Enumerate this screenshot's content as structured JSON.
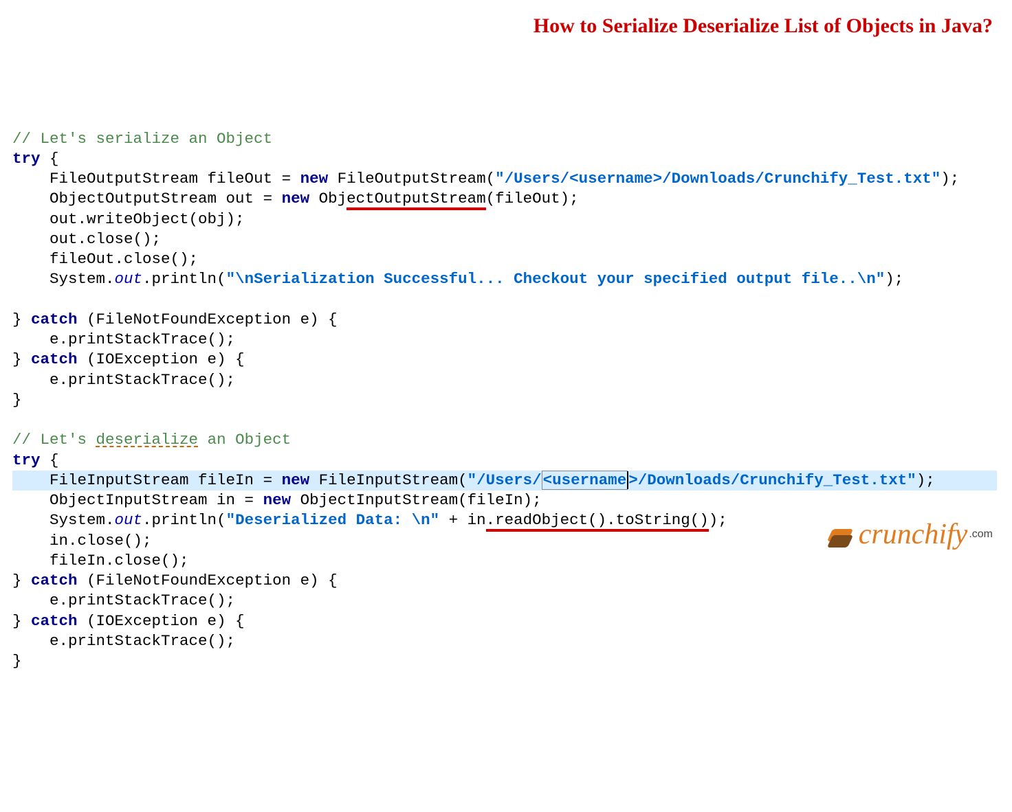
{
  "title": "How to Serialize Deserialize List of Objects in Java?",
  "logo": {
    "name": "crunchify",
    "suffix": ".com"
  },
  "code": {
    "comment1_pre": "// Let's serialize ",
    "comment1_post": "an Object",
    "try": "try",
    "brace_open": " {",
    "ind": "    ",
    "l1_a": "FileOutputStream fileOut = ",
    "kw_new": "new",
    "l1_b": " FileOutputStream(",
    "str1": "\"/Users/<username>/Downloads/Crunchify_Test.txt\"",
    "l1_c": ");",
    "l2_a": "ObjectOutputStream out = ",
    "l2_b1": " Obj",
    "l2_b2_red": "ectOutputStream",
    "l2_b3": "(fileOut);",
    "l3": "out.writeObject(obj);",
    "l4": "out.close();",
    "l5": "fileOut.close();",
    "sys_a": "System.",
    "sys_out": "out",
    "sys_b": ".println(",
    "str2": "\"\\nSerialization Successful... Checkout your specified output file..\\n\"",
    "sys_c": ");",
    "catch": "catch",
    "brace_close_sp": "} ",
    "catch1_sig": " (FileNotFoundException e) {",
    "catch_body": "e.printStackTrace();",
    "catch2_sig": " (IOException e) {",
    "brace_close": "}",
    "comment2_pre": "// Let's ",
    "comment2_word": "deserialize",
    "comment2_post": " an Object",
    "d1_a": "FileInputStream fileIn = ",
    "d1_b": " FileInputStream(",
    "str3_a": "\"/Users/",
    "str3_b_box": "<username",
    "str3_c": ">/Downloads/Crunchify_Test.txt\"",
    "d1_c": ");",
    "d2_a": "ObjectInputStream in = ",
    "d2_b": " ObjectInputStream(fileIn);",
    "d3_b": ".println(",
    "str4": "\"Deserialized Data: \\n\"",
    "d3_c": " + in",
    "d3_red": ".readObject().toString()",
    "d3_d": ");",
    "d4": "in.close();",
    "d5": "fileIn.close();"
  }
}
